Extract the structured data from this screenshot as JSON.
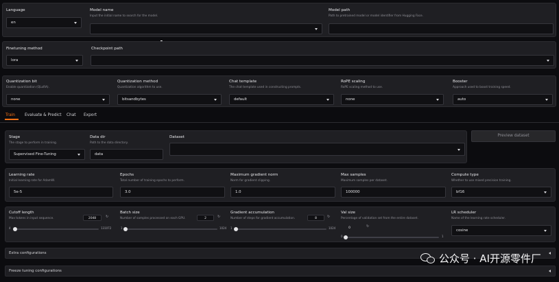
{
  "top": {
    "language": {
      "label": "Language",
      "value": "en"
    },
    "model_name": {
      "label": "Model name",
      "info": "Input the initial name to search for the model.",
      "value": ""
    },
    "model_path": {
      "label": "Model path",
      "info": "Path to pretrained model or model identifier from Hugging Face.",
      "value": ""
    }
  },
  "finetune": {
    "method": {
      "label": "Finetuning method",
      "value": "lora"
    },
    "checkpoint": {
      "label": "Checkpoint path",
      "value": ""
    }
  },
  "advanced": {
    "quant_bit": {
      "label": "Quantization bit",
      "info": "Enable quantization (QLoRA).",
      "value": "none"
    },
    "quant_method": {
      "label": "Quantization method",
      "info": "Quantization algorithm to use.",
      "value": "bitsandbytes"
    },
    "chat_template": {
      "label": "Chat template",
      "info": "The chat template used in constructing prompts.",
      "value": "default"
    },
    "rope": {
      "label": "RoPE scaling",
      "info": "RoPE scaling method to use.",
      "value": "none"
    },
    "booster": {
      "label": "Booster",
      "info": "Approach used to boost training speed.",
      "value": "auto"
    }
  },
  "tabs": [
    {
      "label": "Train",
      "active": true
    },
    {
      "label": "Evaluate & Predict",
      "active": false
    },
    {
      "label": "Chat",
      "active": false
    },
    {
      "label": "Export",
      "active": false
    }
  ],
  "train": {
    "stage": {
      "label": "Stage",
      "info": "The stage to perform in training.",
      "value": "Supervised Fine-Tuning"
    },
    "data_dir": {
      "label": "Data dir",
      "info": "Path to the data directory.",
      "value": "data"
    },
    "dataset": {
      "label": "Dataset",
      "value": ""
    },
    "preview_button": "Preview dataset",
    "learning_rate": {
      "label": "Learning rate",
      "info": "Initial learning rate for AdamW.",
      "value": "5e-5"
    },
    "epochs": {
      "label": "Epochs",
      "info": "Total number of training epochs to perform.",
      "value": "3.0"
    },
    "max_grad_norm": {
      "label": "Maximum gradient norm",
      "info": "Norm for gradient clipping.",
      "value": "1.0"
    },
    "max_samples": {
      "label": "Max samples",
      "info": "Maximum samples per dataset.",
      "value": "100000"
    },
    "compute_type": {
      "label": "Compute type",
      "info": "Whether to use mixed precision training.",
      "value": "bf16"
    },
    "cutoff": {
      "label": "Cutoff length",
      "info": "Max tokens in input sequence.",
      "value": "2048",
      "min": "4",
      "max": "131072",
      "fraction": 0.016
    },
    "batch_size": {
      "label": "Batch size",
      "info": "Number of samples processed on each GPU.",
      "value": "2",
      "min": "1",
      "max": "1024",
      "fraction": 0.001
    },
    "grad_accum": {
      "label": "Gradient accumulation",
      "info": "Number of steps for gradient accumulation.",
      "value": "8",
      "min": "1",
      "max": "1024",
      "fraction": 0.007
    },
    "val_size": {
      "label": "Val size",
      "info": "Percentage of validation set from the entire dataset.",
      "value": "0",
      "min": "0",
      "max": "1",
      "fraction": 0.0
    },
    "lr_scheduler": {
      "label": "LR scheduler",
      "info": "Name of the learning rate scheduler.",
      "value": "cosine"
    }
  },
  "accordions": {
    "extra": "Extra configurations",
    "freeze": "Freeze tuning configurations"
  },
  "watermark": "公众号 · AI开源零件厂",
  "icons": {
    "reset": "reset-icon",
    "dropdown": "chevron-down-icon",
    "collapse": "triangle-left-icon"
  },
  "colors": {
    "accent": "#f97316",
    "panel": "#1f1f23",
    "background": "#0c0c0f"
  }
}
